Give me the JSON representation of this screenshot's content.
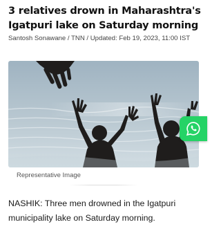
{
  "article": {
    "headline": "3 relatives drown in Maharashtra's Igatpuri lake on Saturday morning",
    "byline": "Santosh Sonawane / TNN / Updated: Feb 19, 2023, 11:00 IST",
    "image_caption": "Representative Image",
    "body": "NASHIK: Three men drowned in the Igatpuri municipality lake on Saturday morning."
  },
  "share": {
    "icon": "whatsapp-icon",
    "color": "#25d366"
  },
  "colors": {
    "water": "#aebfc9",
    "silhouette": "#1f1d1c"
  }
}
